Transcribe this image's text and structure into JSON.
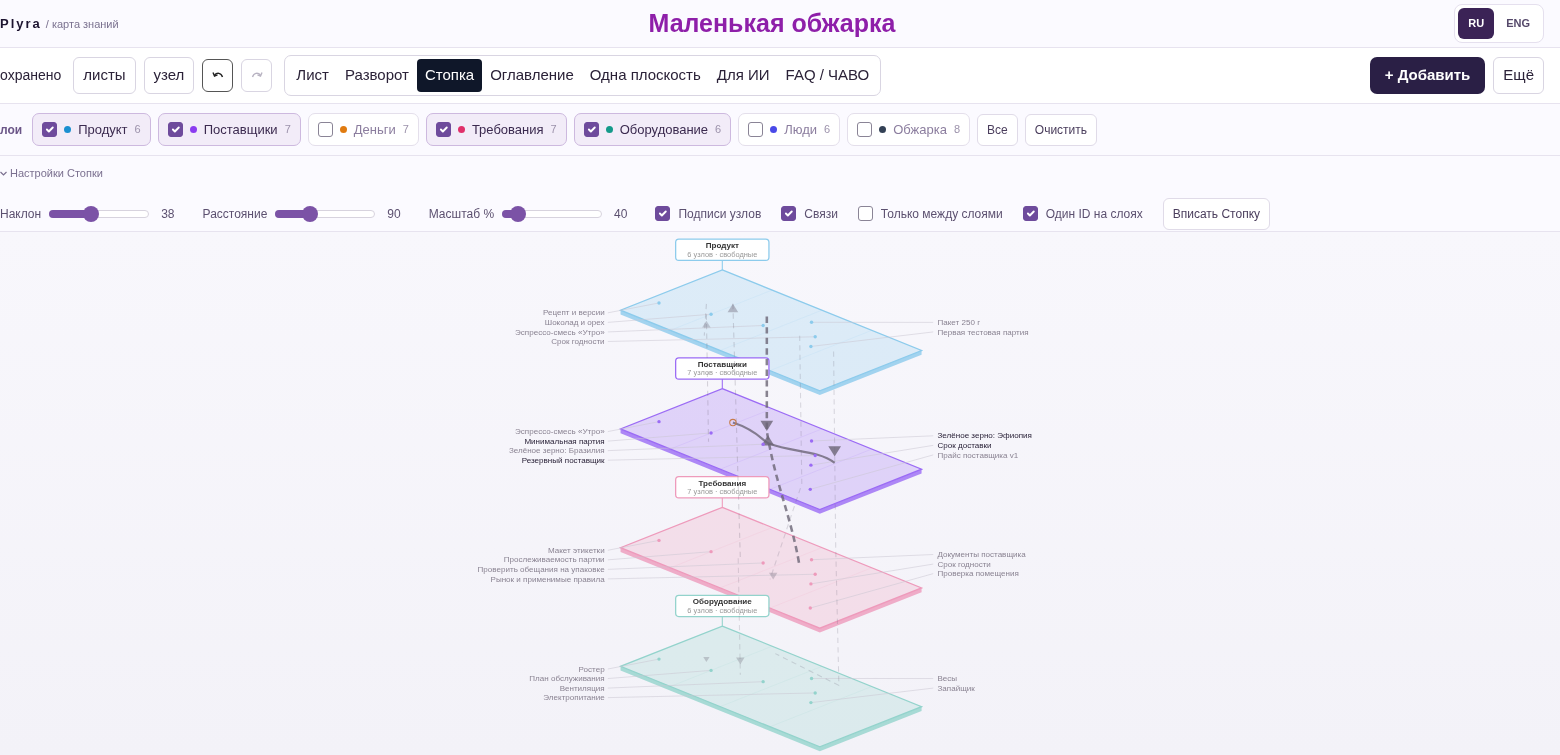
{
  "header": {
    "brand": "Plyra",
    "subtitle": "/ карта знаний",
    "title": "Маленькая обжарка",
    "languages": [
      {
        "label": "RU",
        "selected": true
      },
      {
        "label": "ENG",
        "selected": false
      }
    ]
  },
  "toolbar": {
    "status": "охранено",
    "buttons": [
      "листы",
      "узел"
    ],
    "undo": {
      "disabled": false
    },
    "redo": {
      "disabled": true
    },
    "views": [
      {
        "label": "Лист",
        "selected": false
      },
      {
        "label": "Разворот",
        "selected": false
      },
      {
        "label": "Стопка",
        "selected": true
      },
      {
        "label": "Оглавление",
        "selected": false
      },
      {
        "label": "Одна плоскость",
        "selected": false
      },
      {
        "label": "Для ИИ",
        "selected": false
      },
      {
        "label": "FAQ / ЧАВО",
        "selected": false
      }
    ],
    "add_button": "+ Добавить",
    "more_button": "Ещё"
  },
  "layers": {
    "label": "лои",
    "items": [
      {
        "name": "Продукт",
        "count": "6",
        "color": "#1a8fd0",
        "checked": true
      },
      {
        "name": "Поставщики",
        "count": "7",
        "color": "#8b3cf0",
        "checked": true
      },
      {
        "name": "Деньги",
        "count": "7",
        "color": "#e07b10",
        "checked": false
      },
      {
        "name": "Требования",
        "count": "7",
        "color": "#e0306a",
        "checked": true
      },
      {
        "name": "Оборудование",
        "count": "6",
        "color": "#149a8a",
        "checked": true
      },
      {
        "name": "Люди",
        "count": "6",
        "color": "#4a4ae8",
        "checked": false
      },
      {
        "name": "Обжарка",
        "count": "8",
        "color": "#334155",
        "checked": false
      }
    ],
    "all_button": "Все",
    "clear_button": "Очистить"
  },
  "settings": {
    "title": "Настройки Стопки",
    "expanded": true,
    "sliders": [
      {
        "label": "Наклон",
        "level": 0.4,
        "reading": "38"
      },
      {
        "label": "Расстояние",
        "level": 0.32,
        "reading": "90"
      },
      {
        "label": "Масштаб %",
        "level": 0.09,
        "reading": "40"
      }
    ],
    "options": [
      {
        "label": "Подписи узлов",
        "checked": true
      },
      {
        "label": "Связи",
        "checked": true
      },
      {
        "label": "Только между слоями",
        "checked": false
      },
      {
        "label": "Один ID на слоях",
        "checked": true
      }
    ],
    "fit_button": "Вписать Стопку"
  },
  "stack": {
    "layers": [
      {
        "title": "Продукт",
        "subtitle": "6 узлов · свободные",
        "color": "#8ccbec",
        "left_labels": [
          {
            "text": "Рецепт и версии",
            "highlighted": false
          },
          {
            "text": "Шоколад и орех",
            "highlighted": false
          },
          {
            "text": "Эспрессо-смесь «Утро»",
            "highlighted": false
          },
          {
            "text": "Срок годности",
            "highlighted": false
          }
        ],
        "right_labels": [
          {
            "text": "Пакет 250 г",
            "highlighted": false
          },
          {
            "text": "Первая тестовая партия",
            "highlighted": false
          }
        ]
      },
      {
        "title": "Поставщики",
        "subtitle": "7 узлов · свободные",
        "color": "#9b6bf5",
        "left_labels": [
          {
            "text": "Эспрессо-смесь «Утро»",
            "highlighted": false
          },
          {
            "text": "Минимальная партия",
            "highlighted": true
          },
          {
            "text": "Зелёное зерно: Бразилия",
            "highlighted": false
          },
          {
            "text": "Резервный поставщик",
            "highlighted": true
          }
        ],
        "right_labels": [
          {
            "text": "Зелёное зерно: Эфиопия",
            "highlighted": true
          },
          {
            "text": "Срок доставки",
            "highlighted": true
          },
          {
            "text": "Прайс поставщика v1",
            "highlighted": false
          }
        ]
      },
      {
        "title": "Требования",
        "subtitle": "7 узлов · свободные",
        "color": "#ee9abb",
        "left_labels": [
          {
            "text": "Макет этикетки",
            "highlighted": false
          },
          {
            "text": "Прослеживаемость партии",
            "highlighted": false
          },
          {
            "text": "Проверить обещания на упаковке",
            "highlighted": false
          },
          {
            "text": "Рынок и применимые правила",
            "highlighted": false
          }
        ],
        "right_labels": [
          {
            "text": "Документы поставщика",
            "highlighted": false
          },
          {
            "text": "Срок годности",
            "highlighted": false
          },
          {
            "text": "Проверка помещения",
            "highlighted": false
          }
        ]
      },
      {
        "title": "Оборудование",
        "subtitle": "6 узлов · свободные",
        "color": "#93d3cc",
        "left_labels": [
          {
            "text": "Ростер",
            "highlighted": false
          },
          {
            "text": "План обслуживания",
            "highlighted": false
          },
          {
            "text": "Вентиляция",
            "highlighted": false
          },
          {
            "text": "Электропитание",
            "highlighted": false
          }
        ],
        "right_labels": [
          {
            "text": "Весы",
            "highlighted": false
          },
          {
            "text": "Запайщик",
            "highlighted": false
          }
        ]
      }
    ]
  }
}
